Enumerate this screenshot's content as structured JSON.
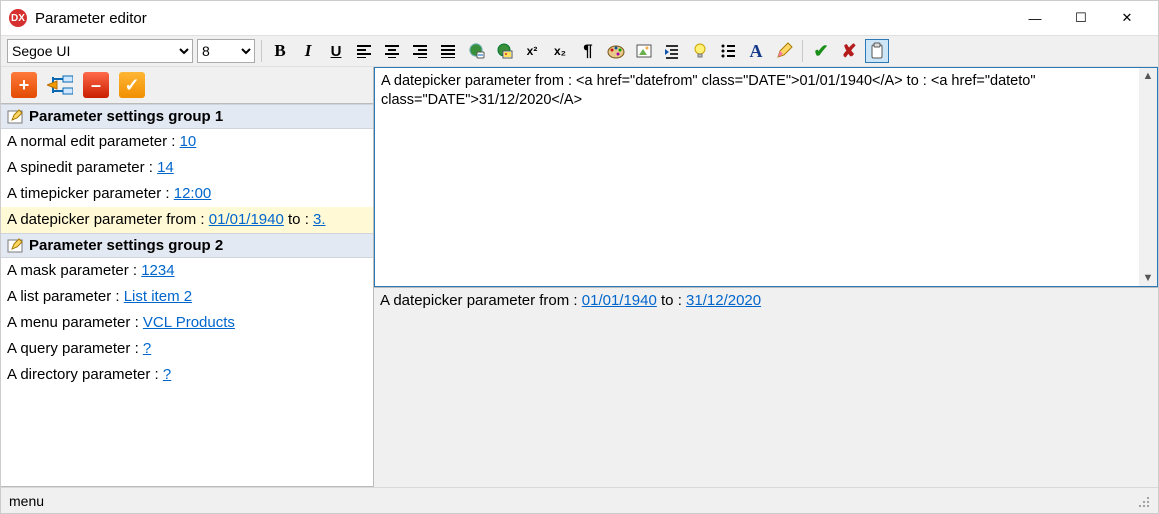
{
  "window": {
    "title": "Parameter editor",
    "app_badge": "DX"
  },
  "winbtns": {
    "minimize": "—",
    "maximize": "☐",
    "close": "✕"
  },
  "toolbar": {
    "font_name": "Segoe UI",
    "font_size": "8",
    "bold": "B",
    "italic": "I",
    "underline": "U",
    "align_left": "≡",
    "align_center": "≡",
    "align_right": "≡",
    "align_just": "≡",
    "sup": "x²",
    "sub": "x₂",
    "pilcrow": "¶",
    "check": "✔",
    "cross": "✘"
  },
  "side_buttons": {
    "add": "+",
    "del": "–",
    "ok": "✓"
  },
  "groups": [
    {
      "title": "Parameter settings group 1",
      "rows": [
        {
          "label": "A normal edit parameter : ",
          "value": "10"
        },
        {
          "label": "A spinedit parameter : ",
          "value": "14"
        },
        {
          "label": "A timepicker parameter : ",
          "value": "12:00"
        },
        {
          "label": "A datepicker parameter from : ",
          "value": "01/01/1940",
          "trail_label": " to : ",
          "trail_value": "3.",
          "selected": true
        }
      ]
    },
    {
      "title": "Parameter settings group 2",
      "rows": [
        {
          "label": "A mask parameter : ",
          "value": "1234"
        },
        {
          "label": "A list parameter : ",
          "value": "List item 2"
        },
        {
          "label": "A menu parameter : ",
          "value": "VCL Products"
        },
        {
          "label": "A query parameter : ",
          "value": "?"
        },
        {
          "label": "A directory parameter : ",
          "value": "?"
        }
      ]
    }
  ],
  "editor": {
    "text": "A datepicker parameter from : <a href=\"datefrom\" class=\"DATE\">01/01/1940</A> to : <a href=\"dateto\" class=\"DATE\">31/12/2020</A>"
  },
  "preview": {
    "prefix": "A datepicker parameter from : ",
    "link1": "01/01/1940",
    "mid": " to : ",
    "link2": "31/12/2020"
  },
  "status": {
    "text": "menu"
  }
}
